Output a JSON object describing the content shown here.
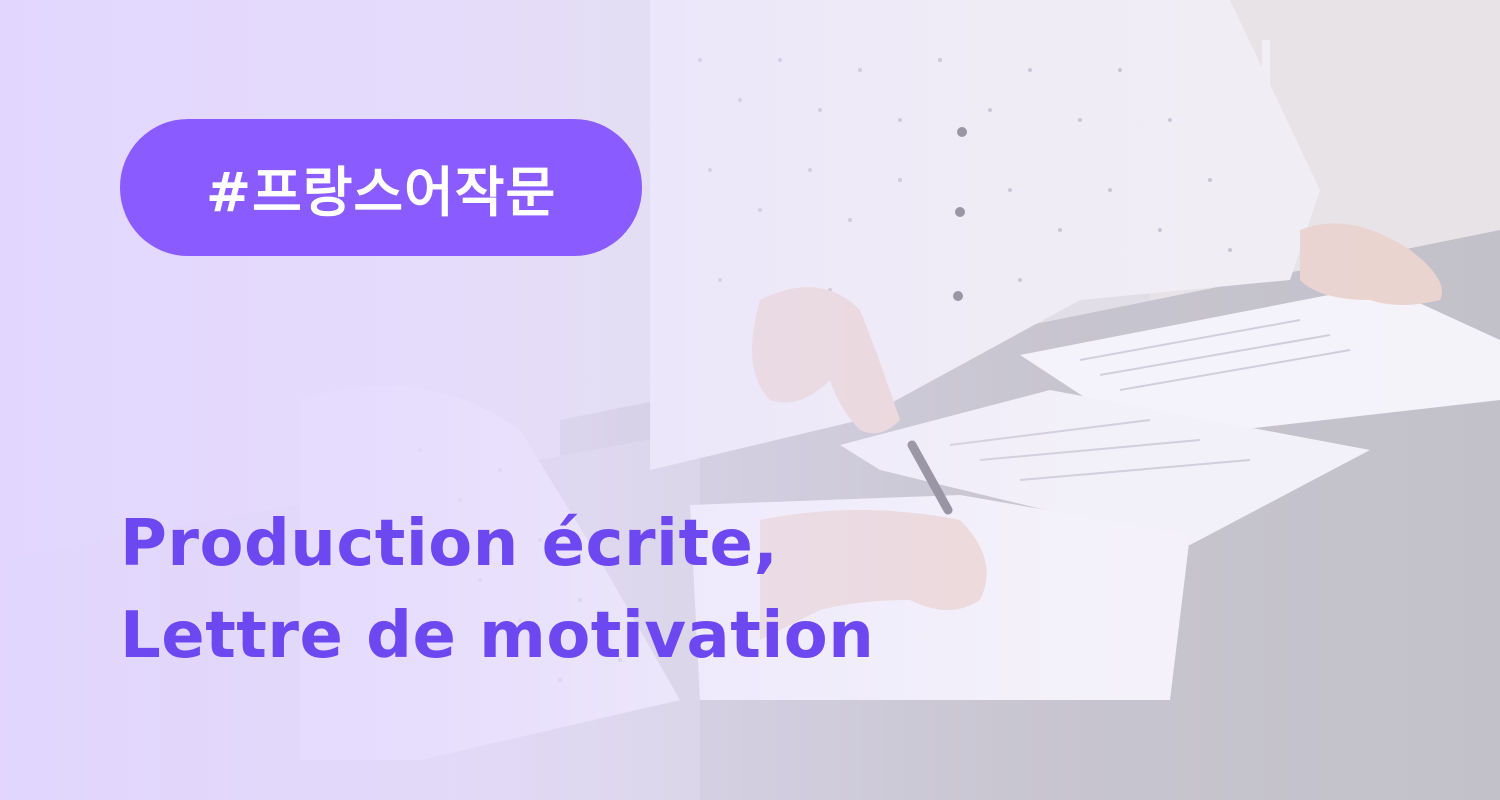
{
  "banner": {
    "hashtag": "#프랑스어작문",
    "title_line1": "Production écrite,",
    "title_line2": "Lettre de motivation"
  },
  "colors": {
    "pill_background": "#8a5cff",
    "pill_text": "#ffffff",
    "headline_text": "#6d48f0",
    "overlay_tint": "#e2d6ff"
  },
  "photo": {
    "subject": "two people at a table reviewing paper documents, one writing with a pen"
  }
}
